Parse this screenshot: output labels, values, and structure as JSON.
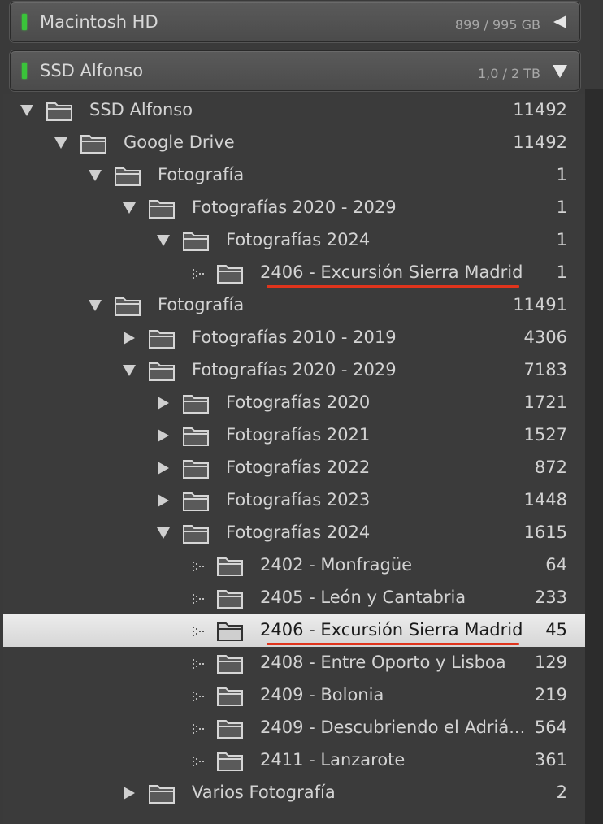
{
  "volumes": [
    {
      "name": "Macintosh HD",
      "size": "899 / 995 GB",
      "expanded": false,
      "led_color": "#3ac43a"
    },
    {
      "name": "SSD Alfonso",
      "size": "1,0 / 2 TB",
      "expanded": true,
      "led_color": "#3ac43a"
    }
  ],
  "accent_underline_color": "#e0341c",
  "selected_row_color": "#e4e4e4",
  "folders": [
    {
      "label": "SSD Alfonso",
      "count": "11492",
      "level": 0,
      "state": "expanded"
    },
    {
      "label": "Google Drive",
      "count": "11492",
      "level": 1,
      "state": "expanded"
    },
    {
      "label": "Fotografía",
      "count": "1",
      "level": 2,
      "state": "expanded"
    },
    {
      "label": "Fotografías 2020 - 2029",
      "count": "1",
      "level": 3,
      "state": "expanded"
    },
    {
      "label": "Fotografías 2024",
      "count": "1",
      "level": 4,
      "state": "expanded"
    },
    {
      "label": "2406 - Excursión Sierra Madrid",
      "count": "1",
      "level": 5,
      "state": "leaf",
      "underlined": true
    },
    {
      "label": "Fotografía",
      "count": "11491",
      "level": 2,
      "state": "expanded"
    },
    {
      "label": "Fotografías 2010 - 2019",
      "count": "4306",
      "level": 3,
      "state": "collapsed"
    },
    {
      "label": "Fotografías 2020 - 2029",
      "count": "7183",
      "level": 3,
      "state": "expanded"
    },
    {
      "label": "Fotografías 2020",
      "count": "1721",
      "level": 4,
      "state": "collapsed"
    },
    {
      "label": "Fotografías 2021",
      "count": "1527",
      "level": 4,
      "state": "collapsed"
    },
    {
      "label": "Fotografías 2022",
      "count": "872",
      "level": 4,
      "state": "collapsed"
    },
    {
      "label": "Fotografías 2023",
      "count": "1448",
      "level": 4,
      "state": "collapsed"
    },
    {
      "label": "Fotografías 2024",
      "count": "1615",
      "level": 4,
      "state": "expanded"
    },
    {
      "label": "2402 - Monfragüe",
      "count": "64",
      "level": 5,
      "state": "leaf"
    },
    {
      "label": "2405 - León y Cantabria",
      "count": "233",
      "level": 5,
      "state": "leaf"
    },
    {
      "label": "2406 - Excursión Sierra Madrid",
      "count": "45",
      "level": 5,
      "state": "leaf",
      "selected": true,
      "underlined": true
    },
    {
      "label": "2408 - Entre Oporto y Lisboa",
      "count": "129",
      "level": 5,
      "state": "leaf"
    },
    {
      "label": "2409 - Bolonia",
      "count": "219",
      "level": 5,
      "state": "leaf"
    },
    {
      "label": "2409 - Descubriendo el Adriá...",
      "count": "564",
      "level": 5,
      "state": "leaf"
    },
    {
      "label": "2411 - Lanzarote",
      "count": "361",
      "level": 5,
      "state": "leaf"
    },
    {
      "label": "Varios Fotografía",
      "count": "2",
      "level": 3,
      "state": "collapsed"
    }
  ]
}
